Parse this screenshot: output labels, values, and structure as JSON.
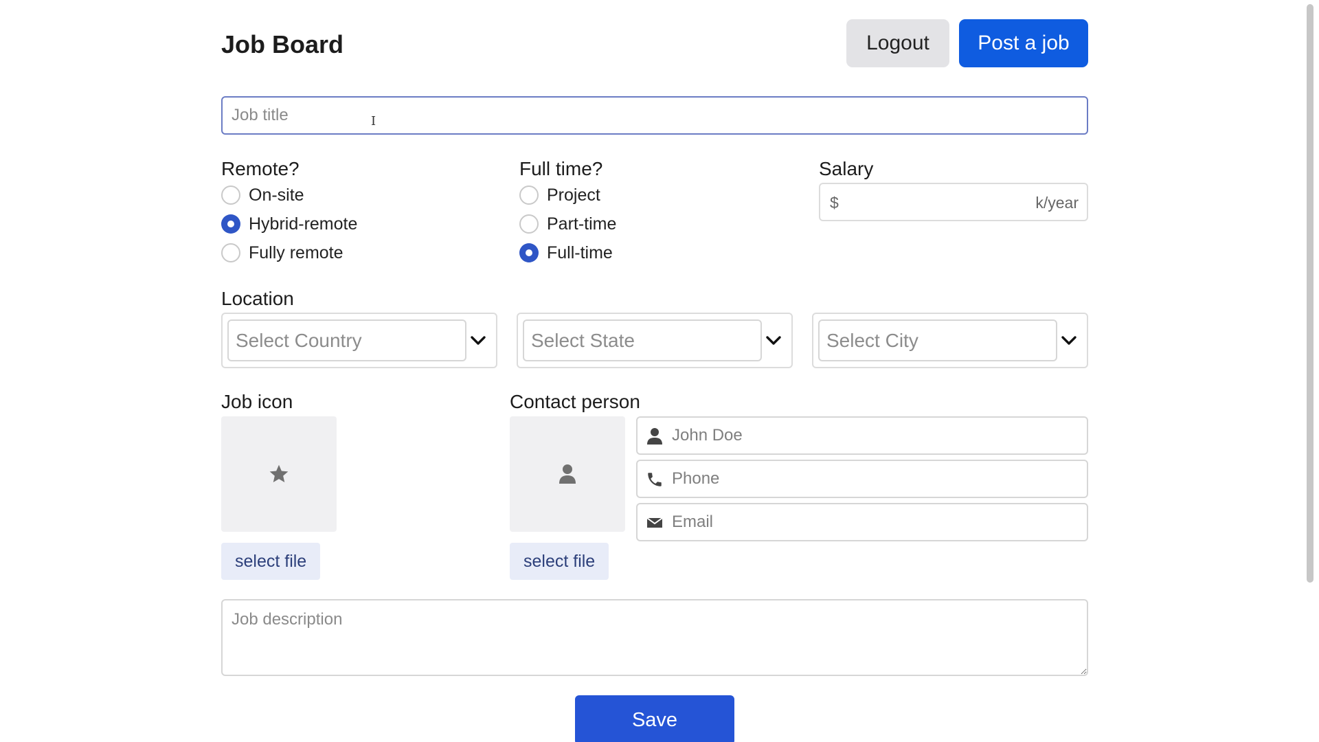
{
  "header": {
    "app_title": "Job Board",
    "logout_label": "Logout",
    "post_job_label": "Post a job"
  },
  "job_title": {
    "placeholder": "Job title",
    "value": ""
  },
  "remote": {
    "label": "Remote?",
    "options": [
      "On-site",
      "Hybrid-remote",
      "Fully remote"
    ],
    "selected": "Hybrid-remote"
  },
  "full_time": {
    "label": "Full time?",
    "options": [
      "Project",
      "Part-time",
      "Full-time"
    ],
    "selected": "Full-time"
  },
  "salary": {
    "label": "Salary",
    "prefix": "$",
    "suffix": "k/year",
    "value": ""
  },
  "location": {
    "label": "Location",
    "country_placeholder": "Select Country",
    "state_placeholder": "Select State",
    "city_placeholder": "Select City"
  },
  "job_icon": {
    "label": "Job icon",
    "icon": "star-icon",
    "select_file_label": "select file"
  },
  "contact": {
    "label": "Contact person",
    "icon": "user-icon",
    "select_file_label": "select file",
    "name_placeholder": "John Doe",
    "phone_placeholder": "Phone",
    "email_placeholder": "Email"
  },
  "description": {
    "placeholder": "Job description"
  },
  "save_label": "Save",
  "colors": {
    "primary": "#0f5ce0",
    "save": "#2554d6",
    "radio_checked": "#2f56c6",
    "focus_border": "#6b7cc4"
  }
}
